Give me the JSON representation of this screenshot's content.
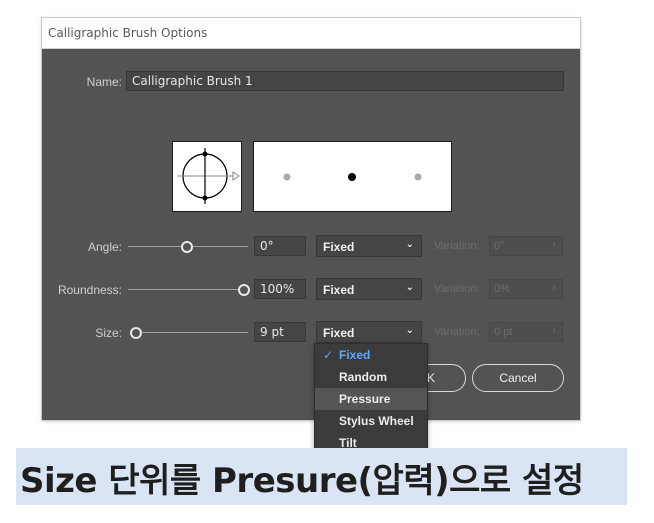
{
  "dialog": {
    "title": "Calligraphic Brush Options",
    "name_label": "Name:",
    "name_value": "Calligraphic Brush 1"
  },
  "rows": {
    "angle": {
      "label": "Angle:",
      "value": "0°",
      "mode": "Fixed",
      "variation_label": "Variation:",
      "variation_value": "0°",
      "slider_fraction": 0.5
    },
    "roundness": {
      "label": "Roundness:",
      "value": "100%",
      "mode": "Fixed",
      "variation_label": "Variation:",
      "variation_value": "0%",
      "slider_fraction": 1.0
    },
    "size": {
      "label": "Size:",
      "value": "9 pt",
      "mode": "Fixed",
      "variation_label": "Variation:",
      "variation_value": "0 pt",
      "slider_fraction": 0.0
    }
  },
  "dropdown": {
    "options": [
      "Fixed",
      "Random",
      "Pressure",
      "Stylus Wheel",
      "Tilt"
    ],
    "selected": "Fixed",
    "highlighted": "Pressure",
    "check_glyph": "✓"
  },
  "buttons": {
    "ok_partial": "K",
    "cancel": "Cancel"
  },
  "caption": {
    "text": "Size 단위를 Presure(압력)으로 설정"
  },
  "icons": {
    "chevron": "chevron-down-icon",
    "chevron_right": "chevron-right-icon",
    "check": "checkmark-icon"
  },
  "colors": {
    "dialog_bg": "#535353",
    "highlight_text": "#5aa8ff",
    "caption_bg": "#d9e5f4"
  }
}
